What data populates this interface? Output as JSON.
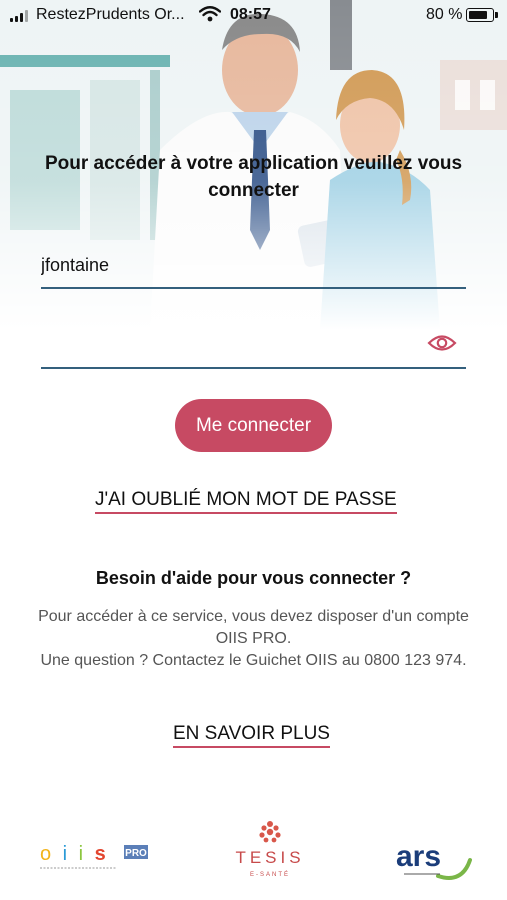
{
  "status_bar": {
    "carrier": "RestezPrudents Or...",
    "time": "08:57",
    "battery_percent": "80 %",
    "battery_level": 0.8
  },
  "login": {
    "intro": "Pour accéder à votre application veuillez vous connecter",
    "username_value": "jfontaine",
    "password_value": "",
    "connect_label": "Me connecter",
    "forgot_label": "J'AI OUBLIÉ MON MOT DE PASSE"
  },
  "help": {
    "title": "Besoin d'aide pour vous connecter ?",
    "text_line1": "Pour accéder à ce service, vous devez disposer d'un compte OIIS PRO.",
    "text_line2": "Une question ? Contactez le Guichet OIIS au 0800 123 974.",
    "more_label": "EN SAVOIR PLUS"
  },
  "logos": {
    "oiis_word": "o i i s",
    "oiis_badge": "PRO",
    "tesis_word": "TESIS",
    "tesis_sub": "E-SANTÉ",
    "ars_word": "ars"
  },
  "colors": {
    "accent": "#c74a63",
    "field_line": "#34607d",
    "ars_blue": "#1b3d7a",
    "ars_green": "#7ab648"
  }
}
